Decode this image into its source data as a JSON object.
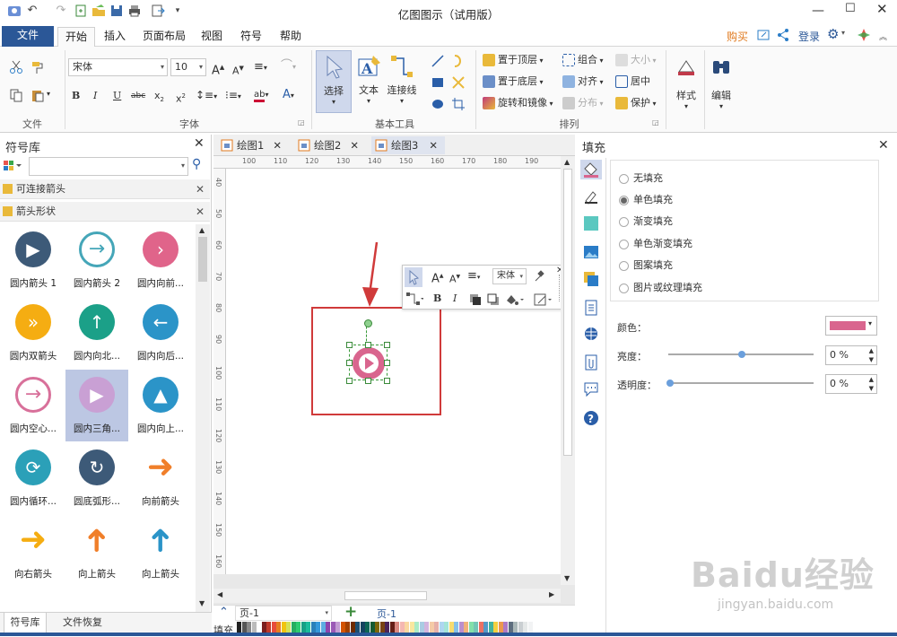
{
  "app_title": "亿图图示（试用版）",
  "menu_tabs": [
    "文件",
    "开始",
    "插入",
    "页面布局",
    "视图",
    "符号",
    "帮助"
  ],
  "right_links": {
    "buy": "购买",
    "login": "登录"
  },
  "ribbon": {
    "groups": {
      "file": "文件",
      "font": "字体",
      "basic_tools": "基本工具",
      "arrange": "排列",
      "style": "样式",
      "edit": "编辑"
    },
    "font_name": "宋体",
    "font_size": "10",
    "tools": {
      "select": "选择",
      "text": "文本",
      "connector": "连接线"
    },
    "arrange": {
      "bring_front": "置于顶层",
      "send_back": "置于底层",
      "rotate_mirror": "旋转和镜像",
      "group": "组合",
      "align": "对齐",
      "distribute": "分布",
      "size": "大小",
      "center": "居中",
      "protect": "保护"
    }
  },
  "left_panel": {
    "title": "符号库",
    "search_placeholder": "",
    "categories": [
      "可连接箭头",
      "箭头形状"
    ],
    "symbols": [
      {
        "label": "圆内箭头 1",
        "color": "#3d5a78"
      },
      {
        "label": "圆内箭头 2",
        "color": "#45a6b8"
      },
      {
        "label": "圆内向前...",
        "color": "#e0648a"
      },
      {
        "label": "圆内双箭头",
        "color": "#f5ad12"
      },
      {
        "label": "圆内向北...",
        "color": "#1ba088"
      },
      {
        "label": "圆内向后...",
        "color": "#2b94c8"
      },
      {
        "label": "圆内空心...",
        "color": "#d8709a"
      },
      {
        "label": "圆内三角...",
        "color": "#c9a0d4"
      },
      {
        "label": "圆内向上...",
        "color": "#2b94c8"
      },
      {
        "label": "圆内循环...",
        "color": "#2ba0b8"
      },
      {
        "label": "圆底弧形...",
        "color": "#3d5a78"
      },
      {
        "label": "向前箭头",
        "color": "#f07f2a"
      },
      {
        "label": "向右箭头",
        "color": "#f5ad12"
      },
      {
        "label": "向上箭头",
        "color": "#f07f2a"
      },
      {
        "label": "向上箭头",
        "color": "#2b94c8"
      }
    ],
    "bottom_tabs": [
      "符号库",
      "文件恢复"
    ]
  },
  "doc_tabs": [
    "绘图1",
    "绘图2",
    "绘图3"
  ],
  "ruler_h": [
    "100",
    "110",
    "120",
    "130",
    "140",
    "150",
    "160",
    "170",
    "180",
    "190"
  ],
  "ruler_v": [
    "40",
    "50",
    "60",
    "70",
    "80",
    "90",
    "100",
    "110",
    "120",
    "130",
    "140",
    "150",
    "160"
  ],
  "page_tab": "页-1",
  "page_tab_active": "页-1",
  "fill_label": "填充",
  "right_panel": {
    "title": "填充",
    "options": [
      "无填充",
      "单色填充",
      "渐变填充",
      "单色渐变填充",
      "图案填充",
      "图片或纹理填充"
    ],
    "selected": 1,
    "color_label": "颜色：",
    "color": "#d9658e",
    "brightness_label": "亮度：",
    "brightness_value": "0 %",
    "transparency_label": "透明度：",
    "transparency_value": "0 %"
  },
  "watermark": {
    "text": "Baidu经验",
    "url": "jingyan.baidu.com"
  }
}
